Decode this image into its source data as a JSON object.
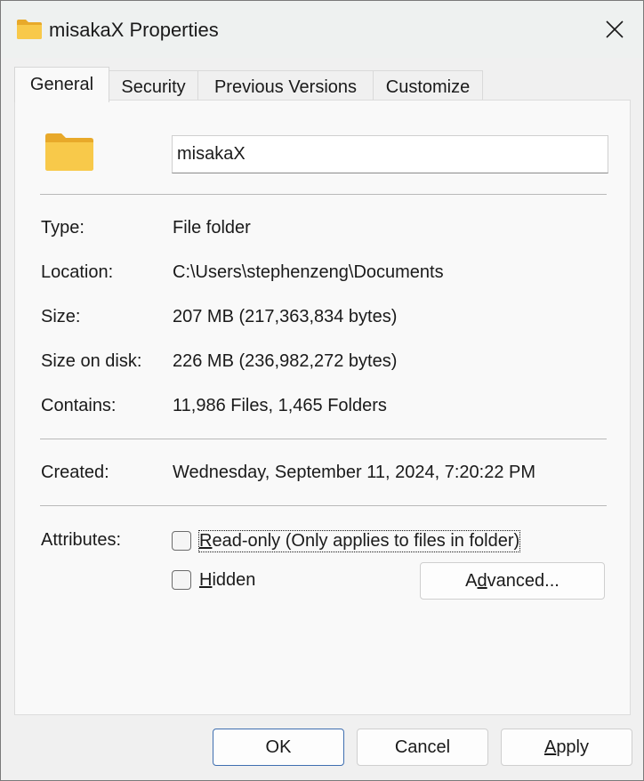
{
  "window": {
    "title": "misakaX Properties",
    "title_icon": "folder-icon",
    "close_icon": "close-icon"
  },
  "tabs": [
    {
      "label": "General",
      "active": true
    },
    {
      "label": "Security",
      "active": false
    },
    {
      "label": "Previous Versions",
      "active": false
    },
    {
      "label": "Customize",
      "active": false
    }
  ],
  "general": {
    "folder_icon": "folder-icon",
    "name": "misakaX",
    "properties": [
      {
        "label": "Type:",
        "value": "File folder"
      },
      {
        "label": "Location:",
        "value": "C:\\Users\\stephenzeng\\Documents"
      },
      {
        "label": "Size:",
        "value": "207 MB (217,363,834 bytes)"
      },
      {
        "label": "Size on disk:",
        "value": "226 MB (236,982,272 bytes)"
      },
      {
        "label": "Contains:",
        "value": "11,986 Files, 1,465 Folders"
      }
    ],
    "created": {
      "label": "Created:",
      "value": "Wednesday, September 11, 2024, 7:20:22 PM"
    },
    "attributes": {
      "label": "Attributes:",
      "readonly": {
        "accel": "R",
        "rest": "ead-only (Only applies to files in folder)",
        "checked": false
      },
      "hidden": {
        "accel": "H",
        "rest": "idden",
        "checked": false
      },
      "advanced": {
        "pre": "A",
        "accel": "d",
        "post": "vanced..."
      }
    }
  },
  "footer": {
    "ok": "OK",
    "cancel": "Cancel",
    "apply_accel": "A",
    "apply_rest": "pply"
  },
  "colors": {
    "folder_yellow": "#f8c94a",
    "primary_border": "#3f6fb0"
  }
}
